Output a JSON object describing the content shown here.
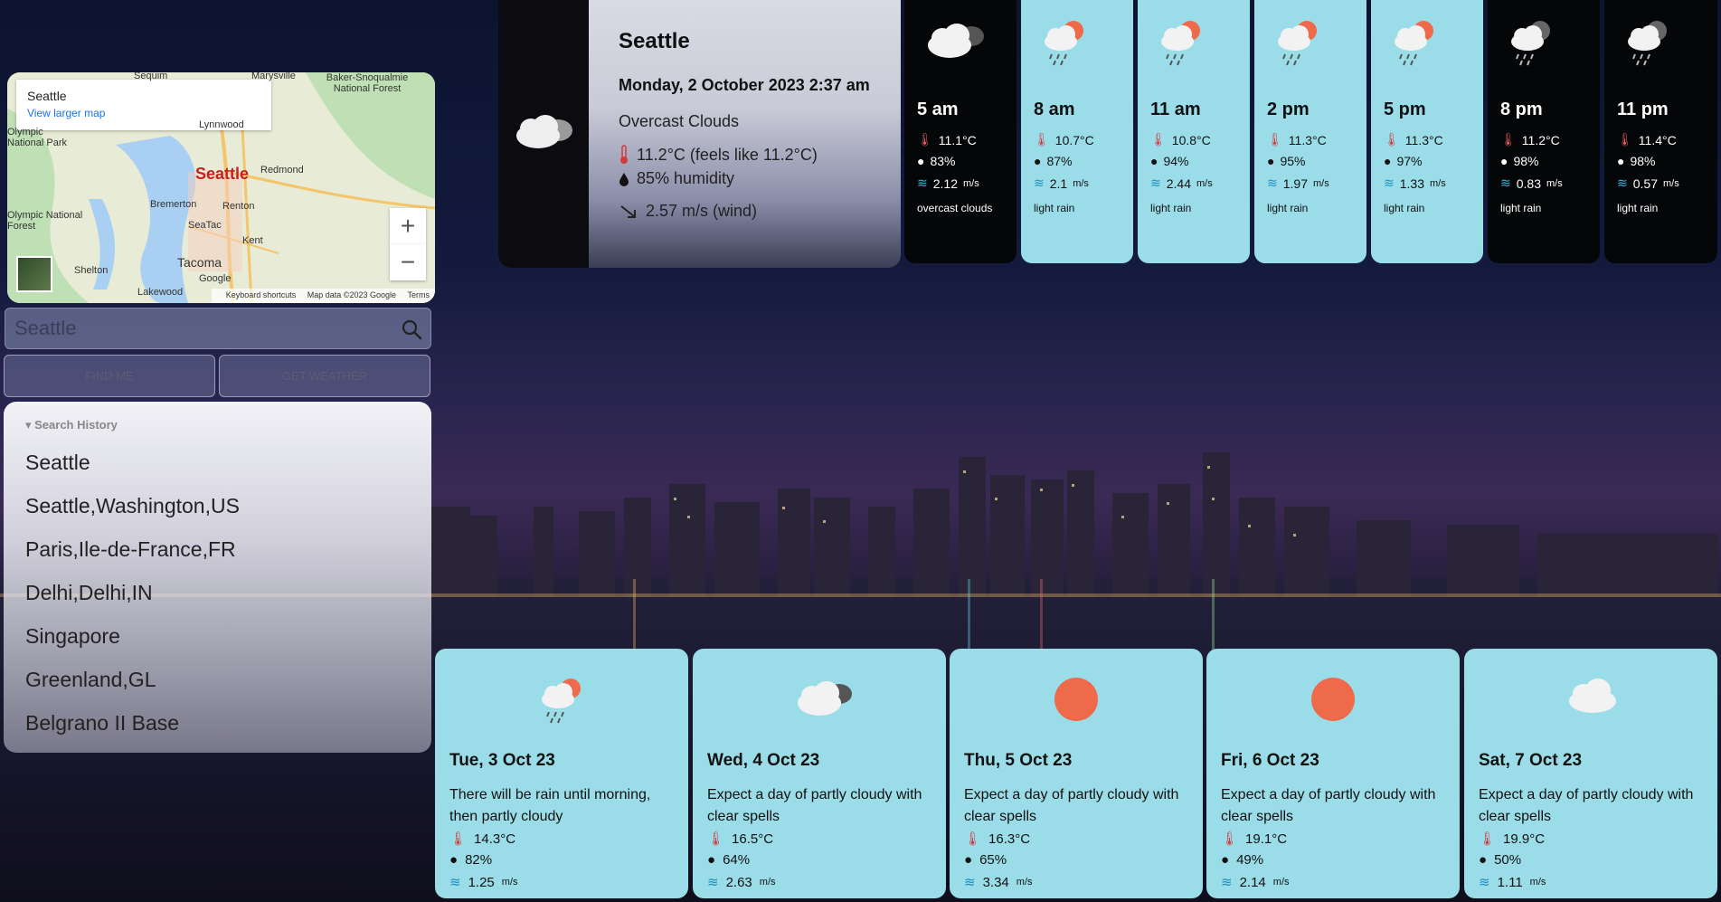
{
  "map": {
    "card_title": "Seattle",
    "card_link": "View larger map",
    "zoom_in": "+",
    "zoom_out": "−",
    "footer_shortcuts": "Keyboard shortcuts",
    "footer_data": "Map data ©2023 Google",
    "footer_terms": "Terms",
    "city_label": "Seattle",
    "places": [
      "Sequim",
      "Marysville",
      "Baker-Snoqualmie National Forest",
      "Olympic National Park",
      "Lynnwood",
      "Redmond",
      "Bremerton",
      "Renton",
      "Olympic National Forest",
      "SeaTac",
      "Kent",
      "Shelton",
      "Tacoma",
      "Lakewood",
      "Google"
    ]
  },
  "search": {
    "value": "Seattle"
  },
  "buttons": {
    "find_me": "FIND ME",
    "get_weather": "GET WEATHER"
  },
  "history": {
    "title": "▾ Search History",
    "items": [
      "Seattle",
      "Seattle,Washington,US",
      "Paris,Ile-de-France,FR",
      "Delhi,Delhi,IN",
      "Singapore",
      "Greenland,GL",
      "Belgrano II Base"
    ]
  },
  "current": {
    "city": "Seattle",
    "date": "Monday, 2 October 2023 2:37 am",
    "description": "Overcast Clouds",
    "temp": "11.2°C (feels like 11.2°C)",
    "humidity": "85% humidity",
    "wind": "2.57 m/s (wind)"
  },
  "hourly": [
    {
      "time": "5 am",
      "temp": "11.1°C",
      "humidity": "83%",
      "wind": "2.12",
      "unit": "m/s",
      "desc": "overcast clouds",
      "icon": "overcast-clouds-icon",
      "theme": "dark"
    },
    {
      "time": "8 am",
      "temp": "10.7°C",
      "humidity": "87%",
      "wind": "2.1",
      "unit": "m/s",
      "desc": "light rain",
      "icon": "light-rain-day-icon",
      "theme": "light"
    },
    {
      "time": "11 am",
      "temp": "10.8°C",
      "humidity": "94%",
      "wind": "2.44",
      "unit": "m/s",
      "desc": "light rain",
      "icon": "light-rain-day-icon",
      "theme": "light"
    },
    {
      "time": "2 pm",
      "temp": "11.3°C",
      "humidity": "95%",
      "wind": "1.97",
      "unit": "m/s",
      "desc": "light rain",
      "icon": "light-rain-day-icon",
      "theme": "light"
    },
    {
      "time": "5 pm",
      "temp": "11.3°C",
      "humidity": "97%",
      "wind": "1.33",
      "unit": "m/s",
      "desc": "light rain",
      "icon": "light-rain-day-icon",
      "theme": "light"
    },
    {
      "time": "8 pm",
      "temp": "11.2°C",
      "humidity": "98%",
      "wind": "0.83",
      "unit": "m/s",
      "desc": "light rain",
      "icon": "light-rain-night-icon",
      "theme": "dark"
    },
    {
      "time": "11 pm",
      "temp": "11.4°C",
      "humidity": "98%",
      "wind": "0.57",
      "unit": "m/s",
      "desc": "light rain",
      "icon": "light-rain-night-icon",
      "theme": "dark"
    }
  ],
  "daily": [
    {
      "date": "Tue, 3 Oct 23",
      "text": "There will be rain until morning, then partly cloudy",
      "temp": "14.3°C",
      "humidity": "82%",
      "wind": "1.25",
      "unit": "m/s",
      "icon": "rain-sun-icon"
    },
    {
      "date": "Wed, 4 Oct 23",
      "text": "Expect a day of partly cloudy with clear spells",
      "temp": "16.5°C",
      "humidity": "64%",
      "wind": "2.63",
      "unit": "m/s",
      "icon": "cloudy-icon"
    },
    {
      "date": "Thu, 5 Oct 23",
      "text": "Expect a day of partly cloudy with clear spells",
      "temp": "16.3°C",
      "humidity": "65%",
      "wind": "3.34",
      "unit": "m/s",
      "icon": "sun-icon"
    },
    {
      "date": "Fri, 6 Oct 23",
      "text": "Expect a day of partly cloudy with clear spells",
      "temp": "19.1°C",
      "humidity": "49%",
      "wind": "2.14",
      "unit": "m/s",
      "icon": "sun-icon"
    },
    {
      "date": "Sat, 7 Oct 23",
      "text": "Expect a day of partly cloudy with clear spells",
      "temp": "19.9°C",
      "humidity": "50%",
      "wind": "1.11",
      "unit": "m/s",
      "icon": "cloud-icon"
    }
  ],
  "colors": {
    "card_light": "#9adde9",
    "card_dark": "#050608",
    "sun": "#ee6a4b",
    "thermometer": "#d33a3a"
  }
}
